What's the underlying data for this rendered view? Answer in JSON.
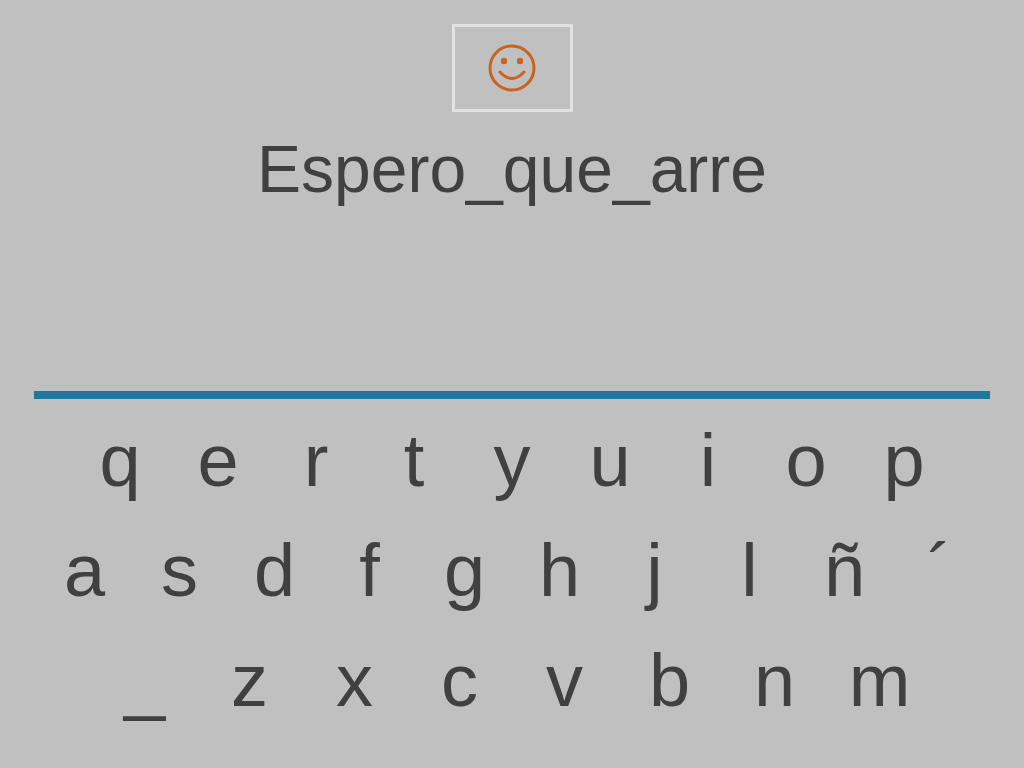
{
  "answer": "Espero_que_arre",
  "keyboard": [
    [
      "q",
      "e",
      "r",
      "t",
      "y",
      "u",
      "i",
      "o",
      "p"
    ],
    [
      "a",
      "s",
      "d",
      "f",
      "g",
      "h",
      "j",
      "l",
      "ñ",
      "´"
    ],
    [
      "_",
      "z",
      "x",
      "c",
      "v",
      "b",
      "n",
      "m"
    ]
  ]
}
